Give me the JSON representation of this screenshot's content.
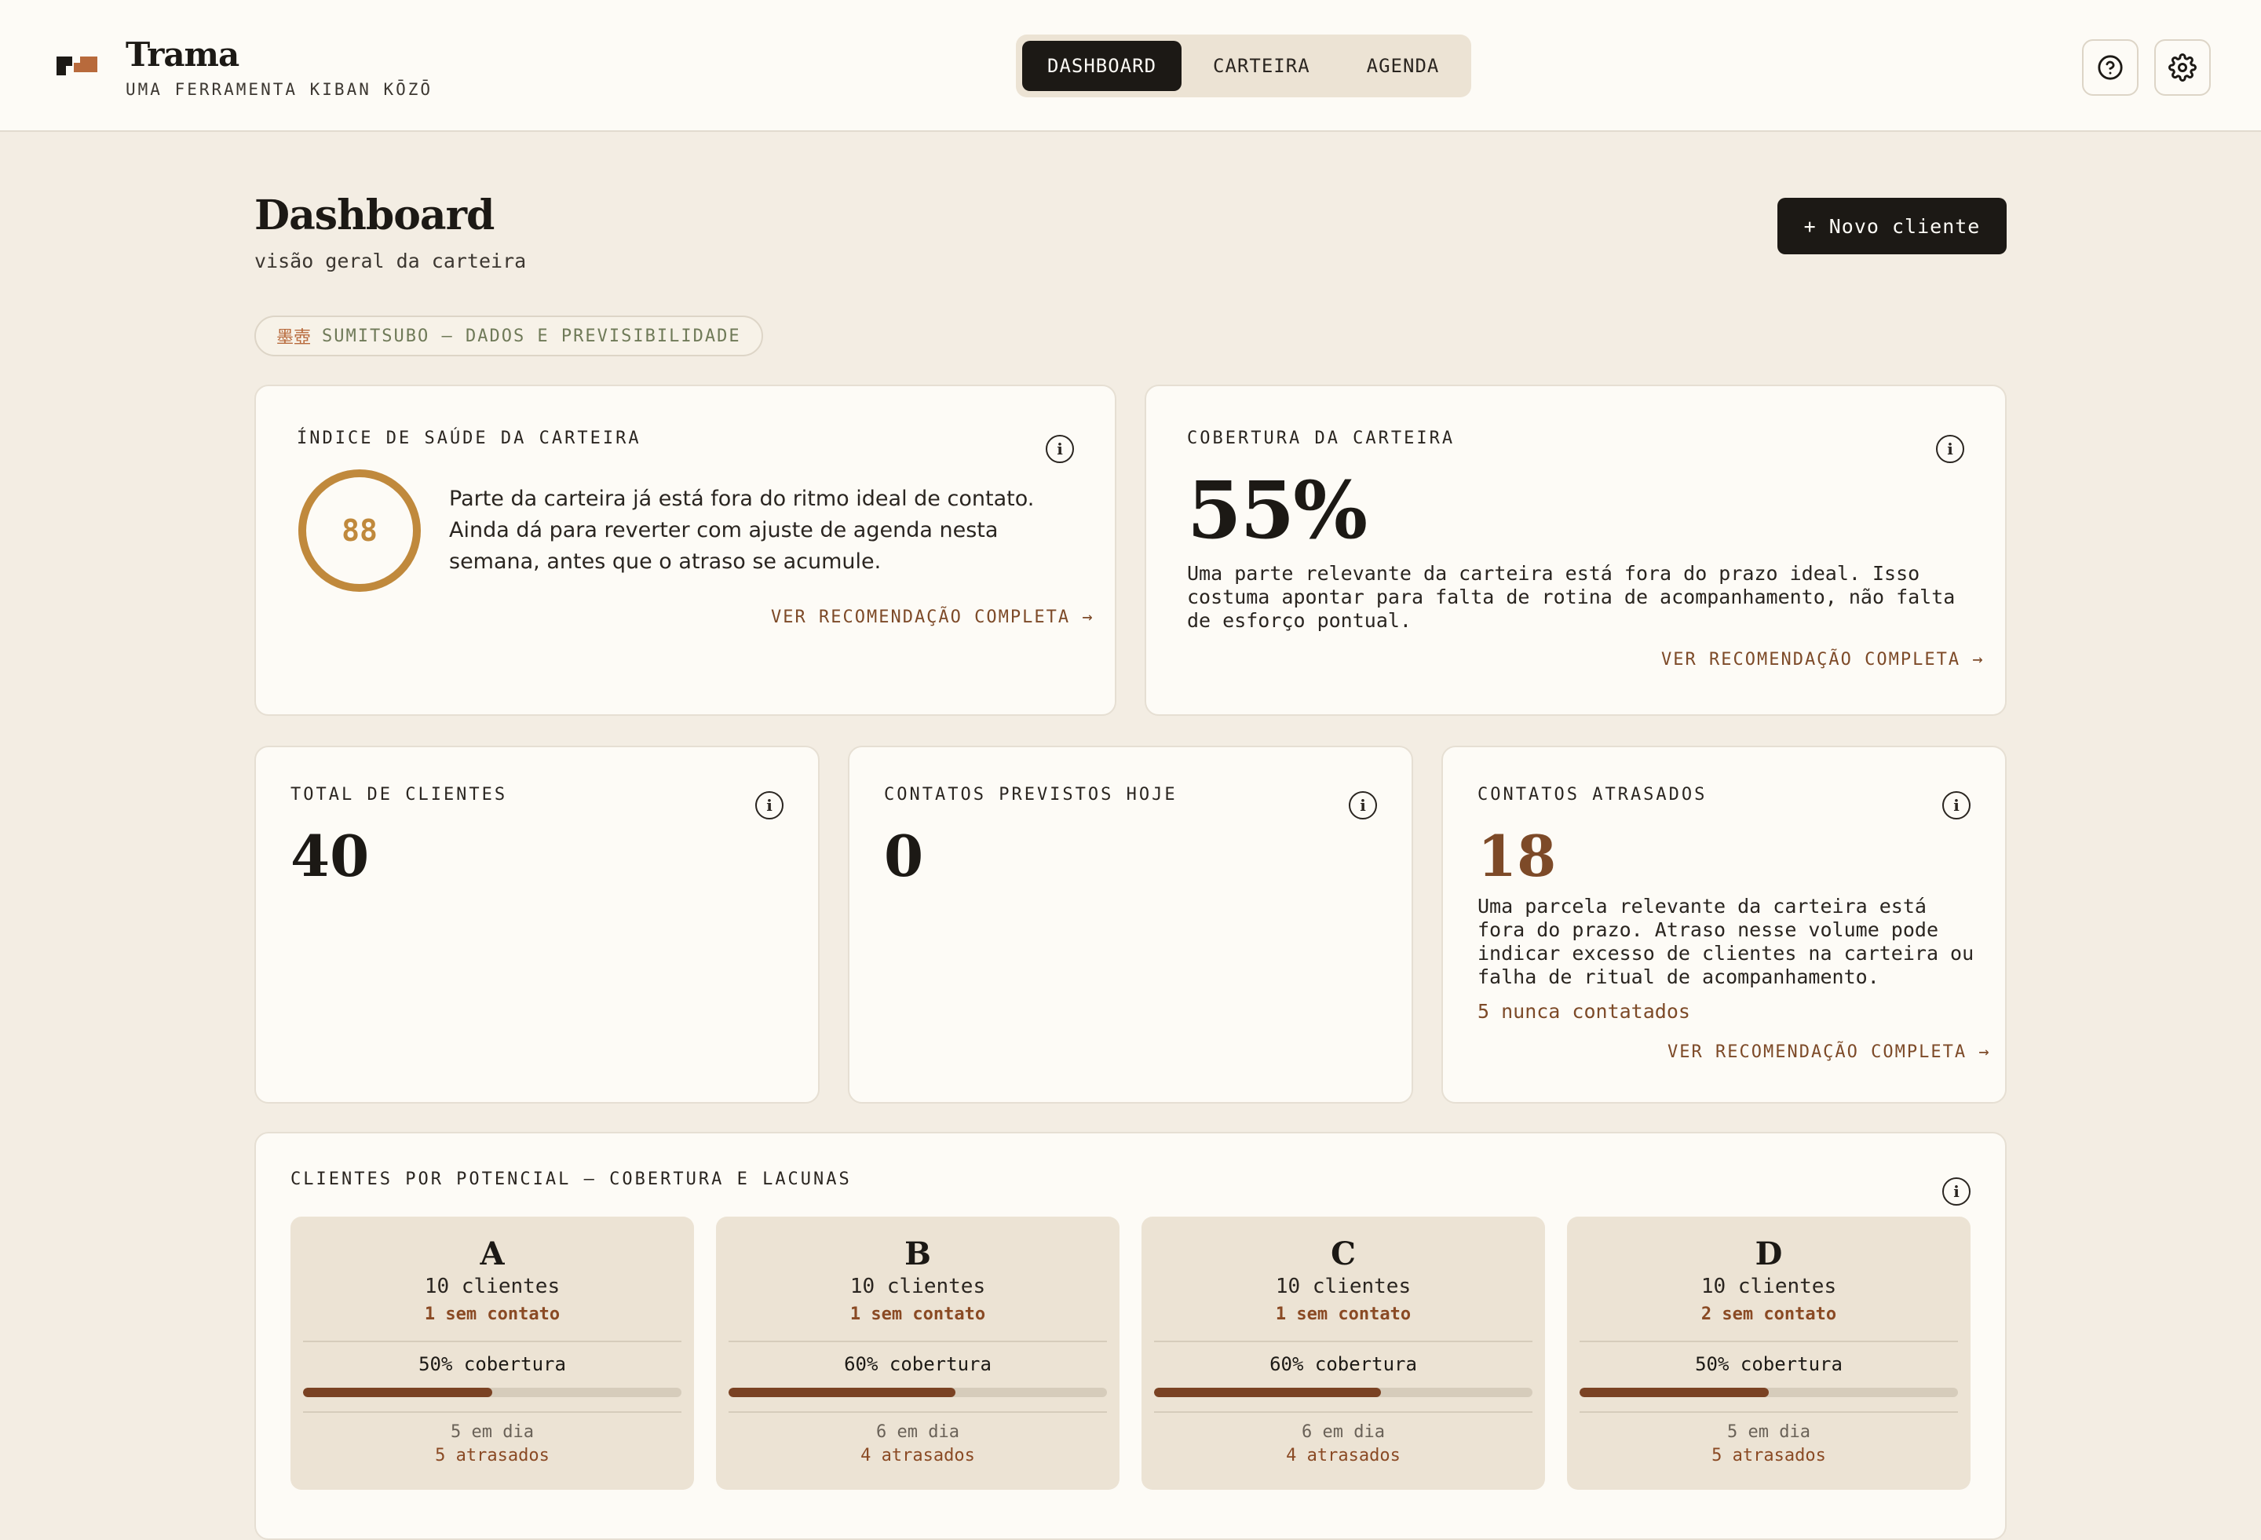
{
  "header": {
    "brand_title": "Trama",
    "brand_subtitle": "UMA FERRAMENTA KIBAN KŌZŌ",
    "tabs": [
      {
        "label": "DASHBOARD",
        "active": true
      },
      {
        "label": "CARTEIRA",
        "active": false
      },
      {
        "label": "AGENDA",
        "active": false
      }
    ],
    "help_icon": "help-circle-icon",
    "settings_icon": "gear-icon"
  },
  "page": {
    "title": "Dashboard",
    "subtitle": "visão geral da carteira",
    "new_client_label": "+ Novo cliente",
    "badge_kanji": "墨壺",
    "badge_text": "SUMITSUBO — DADOS E PREVISIBILIDADE"
  },
  "health": {
    "label": "ÍNDICE DE SAÚDE DA CARTEIRA",
    "score": "88",
    "score_value": 88,
    "text": "Parte da carteira já está fora do ritmo ideal de contato. Ainda dá para reverter com ajuste de agenda nesta semana, antes que o atraso se acumule.",
    "link": "VER RECOMENDAÇÃO COMPLETA →"
  },
  "coverage": {
    "label": "COBERTURA DA CARTEIRA",
    "value": "55%",
    "text": "Uma parte relevante da carteira está fora do prazo ideal. Isso costuma apontar para falta de rotina de acompanhamento, não falta de esforço pontual.",
    "link": "VER RECOMENDAÇÃO COMPLETA →"
  },
  "stats": {
    "total": {
      "label": "TOTAL DE CLIENTES",
      "value": "40"
    },
    "today": {
      "label": "CONTATOS PREVISTOS HOJE",
      "value": "0"
    },
    "late": {
      "label": "CONTATOS ATRASADOS",
      "value": "18",
      "text": "Uma parcela relevante da carteira está fora do prazo. Atraso nesse volume pode indicar excesso de clientes na carteira ou falha de ritual de acompanhamento.",
      "never": "5 nunca contatados",
      "link": "VER RECOMENDAÇÃO COMPLETA →"
    }
  },
  "potential": {
    "label": "CLIENTES POR POTENCIAL — COBERTURA E LACUNAS",
    "tiers": [
      {
        "letter": "A",
        "clients": "10 clientes",
        "no_contact": "1 sem contato",
        "coverage": "50% cobertura",
        "coverage_pct": 50,
        "on_time": "5 em dia",
        "late": "5 atrasados"
      },
      {
        "letter": "B",
        "clients": "10 clientes",
        "no_contact": "1 sem contato",
        "coverage": "60% cobertura",
        "coverage_pct": 60,
        "on_time": "6 em dia",
        "late": "4 atrasados"
      },
      {
        "letter": "C",
        "clients": "10 clientes",
        "no_contact": "1 sem contato",
        "coverage": "60% cobertura",
        "coverage_pct": 60,
        "on_time": "6 em dia",
        "late": "4 atrasados"
      },
      {
        "letter": "D",
        "clients": "10 clientes",
        "no_contact": "2 sem contato",
        "coverage": "50% cobertura",
        "coverage_pct": 50,
        "on_time": "5 em dia",
        "late": "5 atrasados"
      }
    ]
  },
  "colors": {
    "accent_brown": "#7d4a28",
    "ring_gold": "#c0893c",
    "late_red": "#8a4a24",
    "dark": "#1c1915",
    "background": "#f3ede3"
  }
}
